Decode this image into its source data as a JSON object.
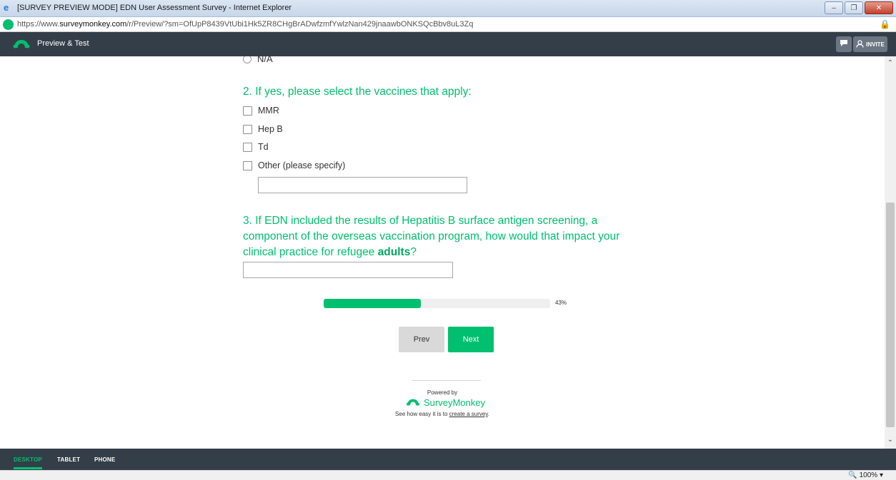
{
  "window": {
    "title": "[SURVEY PREVIEW MODE] EDN User Assessment Survey - Internet Explorer",
    "minimize": "–",
    "restore": "❐",
    "close": "✕"
  },
  "address": {
    "url_prefix": "https://www.",
    "url_domain": "surveymonkey.com",
    "url_path": "/r/Preview/?sm=OfUpP8439VtUbi1Hk5ZR8CHgBrADwfzmfYwlzNan429jnaawbONKSQcBbv8uL3Zq"
  },
  "topbar": {
    "label": "Preview & Test",
    "invite_label": "INVITE"
  },
  "survey": {
    "partial_option": "N/A",
    "q2": {
      "title": "2. If yes, please select the vaccines that apply:",
      "options": [
        "MMR",
        "Hep B",
        "Td",
        "Other (please specify)"
      ],
      "other_value": ""
    },
    "q3": {
      "line1": "3. If EDN included the results of Hepatitis B surface antigen screening, a",
      "line2": "component of the overseas vaccination program, how would that impact your",
      "line3_pre": "clinical practice for refugee ",
      "line3_bold": "adults",
      "line3_post": "?",
      "answer": ""
    },
    "progress": {
      "percent": 43,
      "label": "43%"
    },
    "prev_label": "Prev",
    "next_label": "Next",
    "footer": {
      "powered_by": "Powered by",
      "brand": "SurveyMonkey",
      "tagline_pre": "See how easy it is to ",
      "tagline_link": "create a survey",
      "tagline_post": "."
    }
  },
  "devices": {
    "desktop": "DESKTOP",
    "tablet": "TABLET",
    "phone": "PHONE"
  },
  "status": {
    "zoom": "100%"
  },
  "colors": {
    "brand_green": "#00bf6f",
    "bar_dark": "#333e48"
  }
}
